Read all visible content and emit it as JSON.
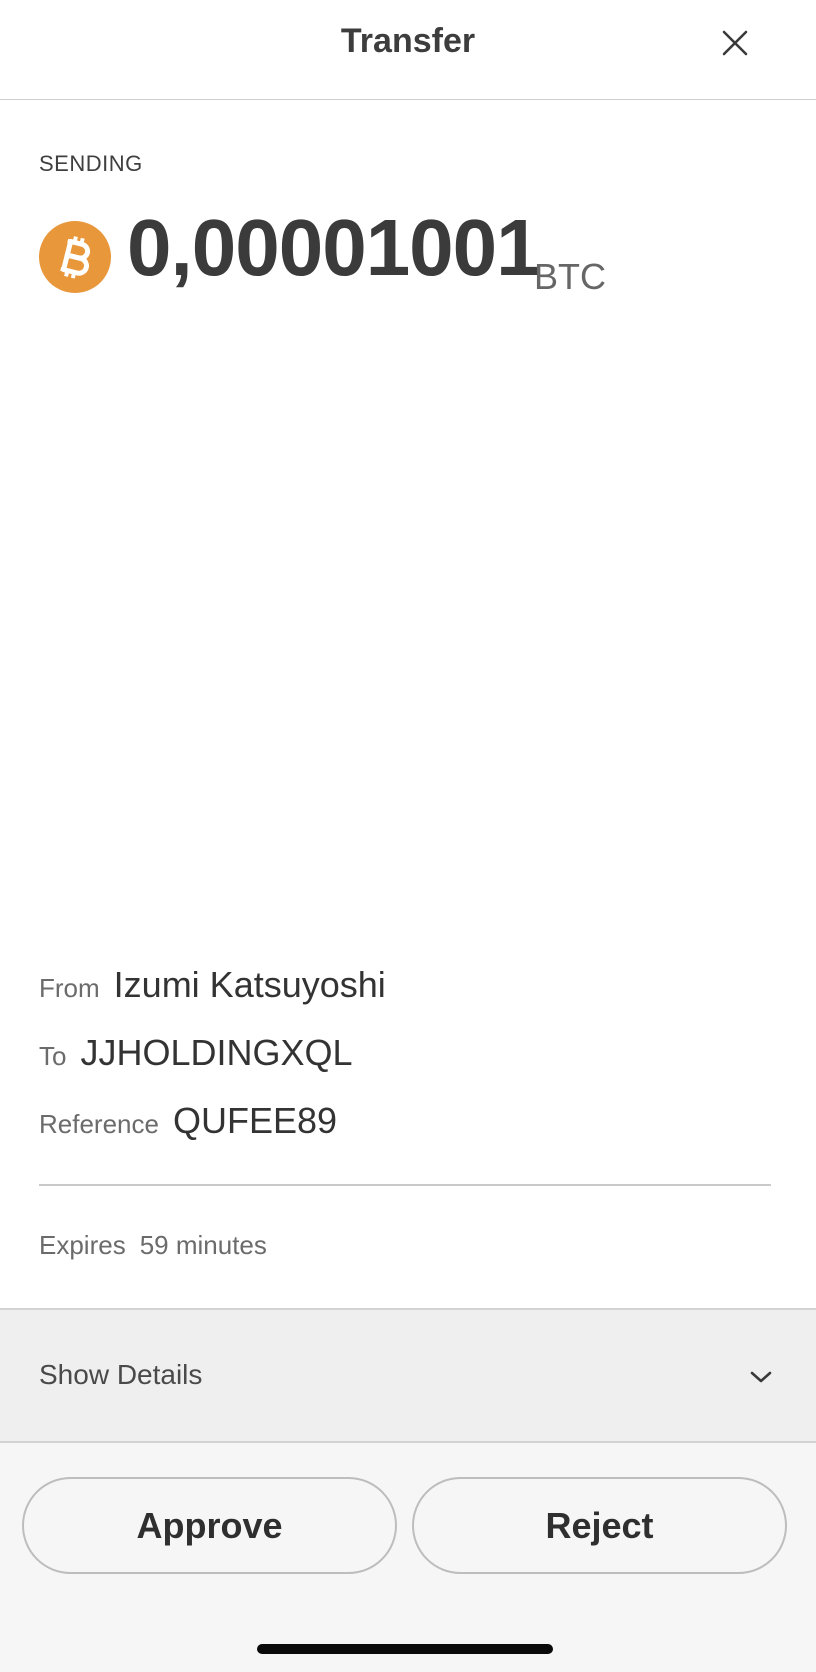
{
  "header": {
    "title": "Transfer",
    "close_icon": "close-icon"
  },
  "sending": {
    "label": "SENDING",
    "icon": "bitcoin-icon",
    "icon_color": "#E8973A",
    "amount": "0,00001001",
    "currency": "BTC"
  },
  "info": {
    "from_label": "From",
    "from_value": "Izumi Katsuyoshi",
    "to_label": "To",
    "to_value": "JJHOLDINGXQL",
    "reference_label": "Reference",
    "reference_value": "QUFEE89"
  },
  "expires": {
    "label": "Expires",
    "value": "59 minutes"
  },
  "details": {
    "label": "Show Details",
    "icon": "chevron-down-icon"
  },
  "actions": {
    "approve_label": "Approve",
    "reject_label": "Reject"
  }
}
